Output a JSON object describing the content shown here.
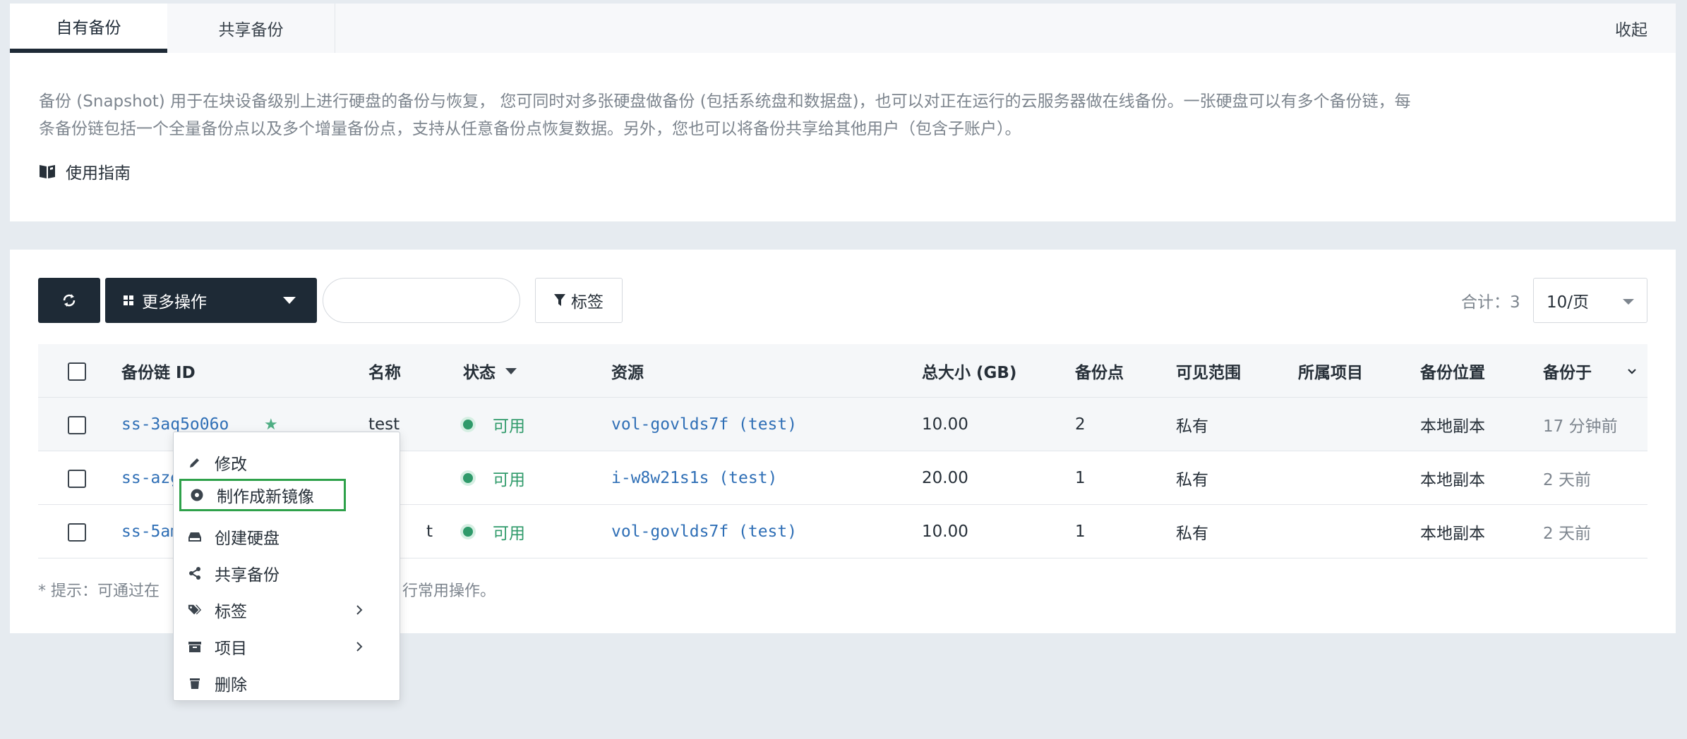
{
  "tabs": [
    {
      "label": "自有备份",
      "active": true
    },
    {
      "label": "共享备份",
      "active": false
    }
  ],
  "collapse_label": "收起",
  "description": "备份 (Snapshot) 用于在块设备级别上进行硬盘的备份与恢复， 您可同时对多张硬盘做备份 (包括系统盘和数据盘)，也可以对正在运行的云服务器做在线备份。一张硬盘可以有多个备份链，每条备份链包括一个全量备份点以及多个增量备份点，支持从任意备份点恢复数据。另外，您也可以将备份共享给其他用户（包含子账户）。",
  "guide_label": "使用指南",
  "toolbar": {
    "more_actions_label": "更多操作",
    "search_placeholder": "",
    "tag_filter_label": "标签",
    "total_label": "合计：3",
    "page_size": "10/页"
  },
  "table": {
    "columns": [
      "备份链 ID",
      "名称",
      "状态",
      "资源",
      "总大小 (GB)",
      "备份点",
      "可见范围",
      "所属项目",
      "备份位置",
      "备份于"
    ],
    "rows": [
      {
        "id": "ss-3aq5o06o",
        "star": "★",
        "name": "test",
        "status": "可用",
        "resource": "vol-govlds7f (test)",
        "size": "10.00",
        "points": "2",
        "scope": "私有",
        "project": "",
        "location": "本地副本",
        "time": "17 分钟前"
      },
      {
        "id": "ss-azg",
        "star": "",
        "name": "",
        "status": "可用",
        "resource": "i-w8w21s1s (test)",
        "size": "20.00",
        "points": "1",
        "scope": "私有",
        "project": "",
        "location": "本地副本",
        "time": "2 天前"
      },
      {
        "id": "ss-5am",
        "star": "",
        "name": "t",
        "status": "可用",
        "resource": "vol-govlds7f (test)",
        "size": "10.00",
        "points": "1",
        "scope": "私有",
        "project": "",
        "location": "本地副本",
        "time": "2 天前"
      }
    ]
  },
  "hint": "* 提示：可通过在",
  "hint_tail": "行常用操作。",
  "context_menu": {
    "items": [
      {
        "label": "修改",
        "icon": "pencil-icon"
      },
      {
        "label": "制作成新镜像",
        "icon": "disc-icon",
        "highlighted": true
      },
      {
        "label": "创建硬盘",
        "icon": "disk-icon"
      },
      {
        "label": "共享备份",
        "icon": "share-icon"
      },
      {
        "label": "标签",
        "icon": "tags-icon",
        "submenu": true
      },
      {
        "label": "项目",
        "icon": "archive-icon",
        "submenu": true
      },
      {
        "label": "删除",
        "icon": "trash-icon"
      }
    ]
  },
  "colors": {
    "dark": "#1e2a36",
    "link": "#2f6fb6",
    "success": "#2f9a6a",
    "highlight_border": "#2ea14a"
  }
}
